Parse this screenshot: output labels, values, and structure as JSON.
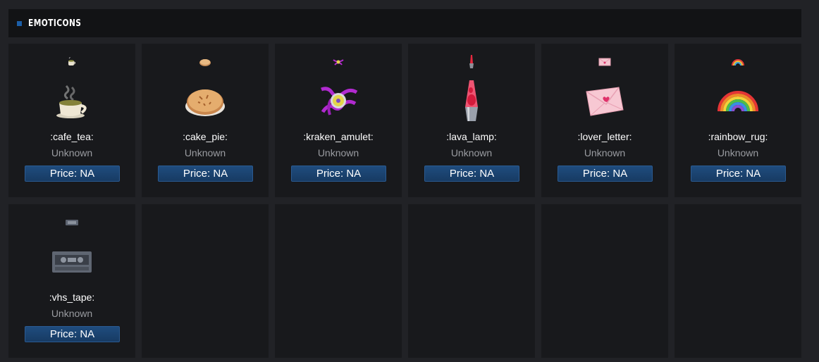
{
  "section": {
    "title": "EMOTICONS"
  },
  "colors": {
    "accent": "#1c5fa8",
    "card_bg": "#18191c",
    "page_bg": "#212226",
    "header_bg": "#121315"
  },
  "items": [
    {
      "icon": "cafe-tea-icon",
      "name": ":cafe_tea:",
      "status": "Unknown",
      "price": "Price: NA"
    },
    {
      "icon": "cake-pie-icon",
      "name": ":cake_pie:",
      "status": "Unknown",
      "price": "Price: NA"
    },
    {
      "icon": "kraken-amulet-icon",
      "name": ":kraken_amulet:",
      "status": "Unknown",
      "price": "Price: NA"
    },
    {
      "icon": "lava-lamp-icon",
      "name": ":lava_lamp:",
      "status": "Unknown",
      "price": "Price: NA"
    },
    {
      "icon": "lover-letter-icon",
      "name": ":lover_letter:",
      "status": "Unknown",
      "price": "Price: NA"
    },
    {
      "icon": "rainbow-rug-icon",
      "name": ":rainbow_rug:",
      "status": "Unknown",
      "price": "Price: NA"
    },
    {
      "icon": "vhs-tape-icon",
      "name": ":vhs_tape:",
      "status": "Unknown",
      "price": "Price: NA"
    }
  ]
}
